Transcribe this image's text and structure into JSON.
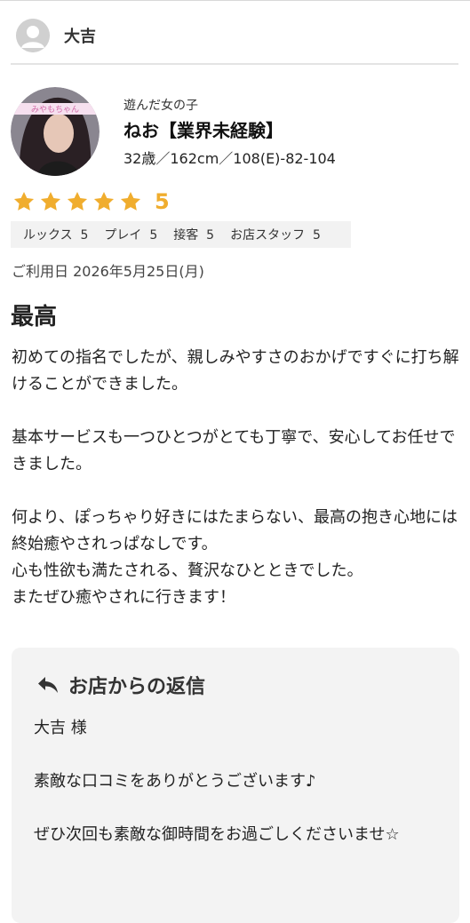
{
  "header": {
    "user_name": "大吉"
  },
  "girl": {
    "label": "遊んだ女の子",
    "name": "ねお【業界未経験】",
    "stats": "32歳／162cm／108(E)-82-104",
    "photo_band_text": "みやもちゃん"
  },
  "rating": {
    "stars": 5,
    "score": "5",
    "star_color": "#f0ad2e",
    "categories": [
      {
        "label": "ルックス",
        "value": "5"
      },
      {
        "label": "プレイ",
        "value": "5"
      },
      {
        "label": "接客",
        "value": "5"
      },
      {
        "label": "お店スタッフ",
        "value": "5"
      }
    ]
  },
  "review": {
    "visit_date": "ご利用日 2026年5月25日(月)",
    "title": "最高",
    "body": "初めての指名でしたが、親しみやすさのおかげですぐに打ち解けることができました。\n\n基本サービスも一つひとつがとても丁寧で、安心してお任せできました。\n\n何より、ぽっちゃり好きにはたまらない、最高の抱き心地には終始癒やされっぱなしです。\n心も性欲も満たされる、贅沢なひとときでした。\nまたぜひ癒やされに行きます！"
  },
  "reply": {
    "title": "お店からの返信",
    "icon": "reply-arrow-icon",
    "body": "大吉 様\n\n素敵な口コミをありがとうございます♪\n\nぜひ次回も素敵な御時間をお過ごしくださいませ☆"
  }
}
